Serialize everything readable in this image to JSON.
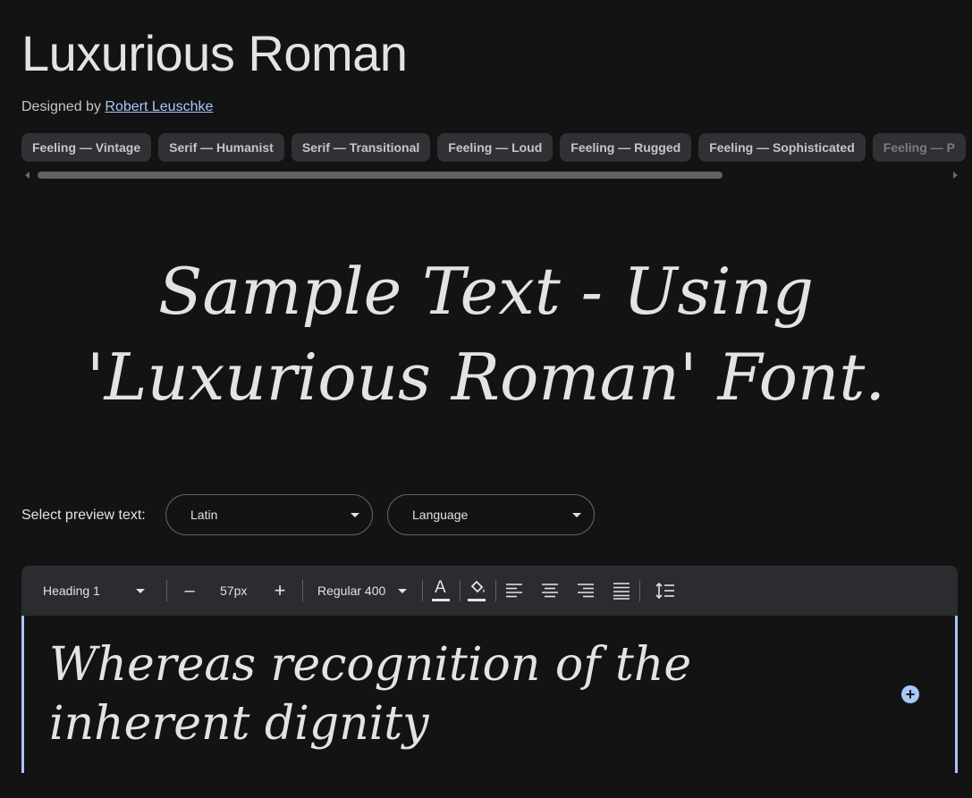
{
  "font": {
    "title": "Luxurious Roman",
    "designed_by_label": "Designed by",
    "designer_name": "Robert Leuschke"
  },
  "tags": [
    "Feeling — Vintage",
    "Serif — Humanist",
    "Serif — Transitional",
    "Feeling — Loud",
    "Feeling — Rugged",
    "Feeling — Sophisticated",
    "Feeling — P"
  ],
  "sample": {
    "line1": "Sample Text - Using",
    "line2": "'Luxurious Roman' Font."
  },
  "preview": {
    "label": "Select preview text:",
    "script_value": "Latin",
    "language_value": "Language"
  },
  "toolbar": {
    "style_value": "Heading 1",
    "decrease_label": "–",
    "size_value": "57px",
    "increase_label": "+",
    "weight_value": "Regular 400",
    "text_color_label": "A"
  },
  "editor": {
    "text": "Whereas recognition of the inherent dignity",
    "add_label": "+"
  },
  "colors": {
    "background": "#131314",
    "accent": "#a8c7fa",
    "chip": "#303134",
    "toolbar": "#2b2c2f"
  },
  "icons": {
    "text_color": "text-color-icon",
    "fill_color": "fill-color-icon",
    "align_left": "align-left-icon",
    "align_center": "align-center-icon",
    "align_right": "align-right-icon",
    "align_justify": "align-justify-icon",
    "line_height": "line-height-icon",
    "add": "add-circle-icon"
  }
}
